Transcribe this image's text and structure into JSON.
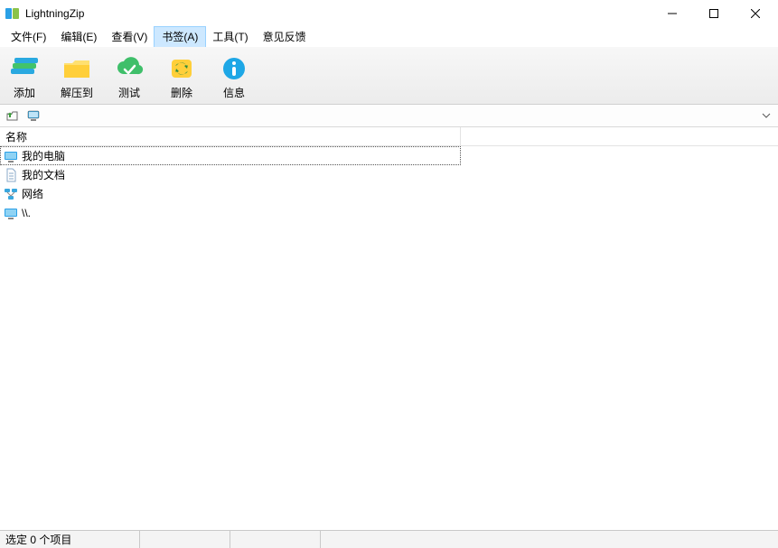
{
  "app": {
    "title": "LightningZip"
  },
  "menu": {
    "items": [
      {
        "label": "文件(F)"
      },
      {
        "label": "编辑(E)"
      },
      {
        "label": "查看(V)"
      },
      {
        "label": "书签(A)",
        "highlight": true
      },
      {
        "label": "工具(T)"
      },
      {
        "label": "意见反馈"
      }
    ]
  },
  "toolbar": {
    "add": "添加",
    "extract": "解压到",
    "test": "测试",
    "delete": "删除",
    "info": "信息"
  },
  "list": {
    "col_name": "名称",
    "rows": [
      {
        "label": "我的电脑",
        "kind": "computer",
        "selected": true
      },
      {
        "label": "我的文档",
        "kind": "document",
        "selected": false
      },
      {
        "label": "网络",
        "kind": "network",
        "selected": false
      },
      {
        "label": "\\\\.",
        "kind": "computer",
        "selected": false
      }
    ]
  },
  "status": {
    "selection": "选定 0 个项目"
  }
}
